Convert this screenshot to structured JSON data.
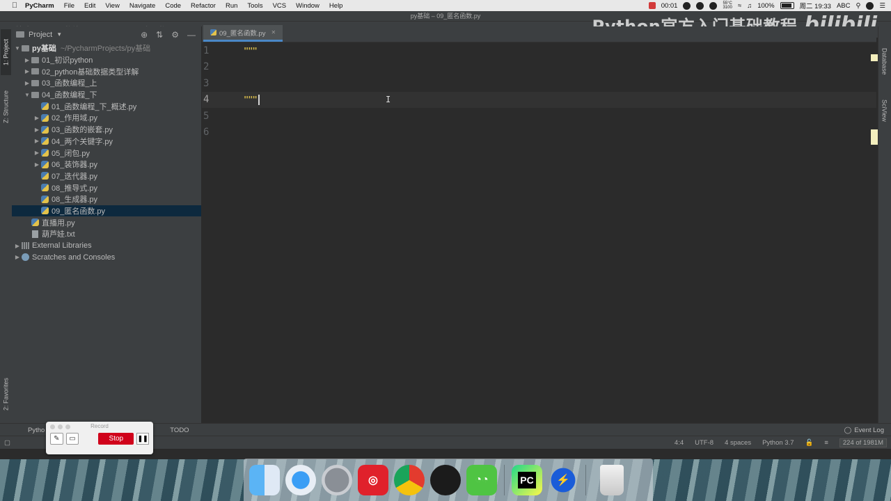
{
  "menubar": {
    "app_name": "PyCharm",
    "items": [
      "File",
      "Edit",
      "View",
      "Navigate",
      "Code",
      "Refactor",
      "Run",
      "Tools",
      "VCS",
      "Window",
      "Help"
    ],
    "record_time": "00:01",
    "temp": "55°C\n3100",
    "battery": "100%",
    "datetime": "周二 19:33",
    "input": "ABC"
  },
  "window": {
    "title": "py基础 – 09_匿名函数.py"
  },
  "navbar": {
    "crumbs": [
      "py基础",
      "04_函数编程_下",
      "09_匿名函数.py"
    ]
  },
  "watermark": {
    "text": "Python官方入门基础教程",
    "logo": "bilibili"
  },
  "left_strip": {
    "project_tab": "1: Project",
    "structure_tab": "Z: Structure",
    "favorites_tab": "2: Favorites"
  },
  "project_panel": {
    "title": "Project",
    "root": {
      "name": "py基础",
      "path": "~/PycharmProjects/py基础"
    },
    "items": [
      {
        "label": "01_初识python",
        "kind": "folder",
        "level": 1
      },
      {
        "label": "02_python基础数据类型详解",
        "kind": "folder",
        "level": 1
      },
      {
        "label": "03_函数编程_上",
        "kind": "folder",
        "level": 1
      },
      {
        "label": "04_函数编程_下",
        "kind": "folder-open",
        "level": 1
      },
      {
        "label": "01_函数编程_下_概述.py",
        "kind": "py",
        "level": 2
      },
      {
        "label": "02_作用域.py",
        "kind": "py-arrow",
        "level": 2
      },
      {
        "label": "03_函数的嵌套.py",
        "kind": "py-arrow",
        "level": 2
      },
      {
        "label": "04_两个关键字.py",
        "kind": "py-arrow",
        "level": 2
      },
      {
        "label": "05_闭包.py",
        "kind": "py-arrow",
        "level": 2
      },
      {
        "label": "06_装饰器.py",
        "kind": "py-arrow",
        "level": 2
      },
      {
        "label": "07_迭代器.py",
        "kind": "py",
        "level": 2
      },
      {
        "label": "08_推导式.py",
        "kind": "py",
        "level": 2
      },
      {
        "label": "08_生成器.py",
        "kind": "py",
        "level": 2
      },
      {
        "label": "09_匿名函数.py",
        "kind": "py-selected",
        "level": 2
      },
      {
        "label": "直播用.py",
        "kind": "py",
        "level": 1
      },
      {
        "label": "葫芦娃.txt",
        "kind": "txt",
        "level": 1
      },
      {
        "label": "External Libraries",
        "kind": "lib",
        "level": 0
      },
      {
        "label": "Scratches and Consoles",
        "kind": "scratch",
        "level": 0
      }
    ]
  },
  "editor": {
    "tab_label": "09_匿名函数.py",
    "lines": [
      {
        "num": "1",
        "text": "\"\"\""
      },
      {
        "num": "2",
        "text": ""
      },
      {
        "num": "3",
        "text": ""
      },
      {
        "num": "4",
        "text": "\"\"\""
      },
      {
        "num": "5",
        "text": ""
      },
      {
        "num": "6",
        "text": ""
      }
    ],
    "current_line": 4
  },
  "right_strip": {
    "database_tab": "Database",
    "sciview_tab": "SciView"
  },
  "toolwindows": {
    "python_console": "Pytho",
    "todo": "TODO",
    "event_log": "Event Log"
  },
  "statusbar": {
    "position": "4:4",
    "encoding": "UTF-8",
    "indent": "4 spaces",
    "interpreter": "Python 3.7",
    "memory": "224 of 1981M"
  },
  "record_widget": {
    "title": "Record",
    "stop_label": "Stop"
  },
  "dock": {
    "apps": [
      "Finder",
      "Safari",
      "Launchpad",
      "NetEase Music",
      "Chrome",
      "QQ",
      "WeChat",
      "PyCharm",
      "Thunder",
      "Trash"
    ]
  },
  "colors": {
    "ide_bg": "#2b2b2b",
    "panel_bg": "#3c3f41",
    "selection": "#0d293e",
    "docstring": "#d4b84a",
    "stop_red": "#d0021b"
  }
}
